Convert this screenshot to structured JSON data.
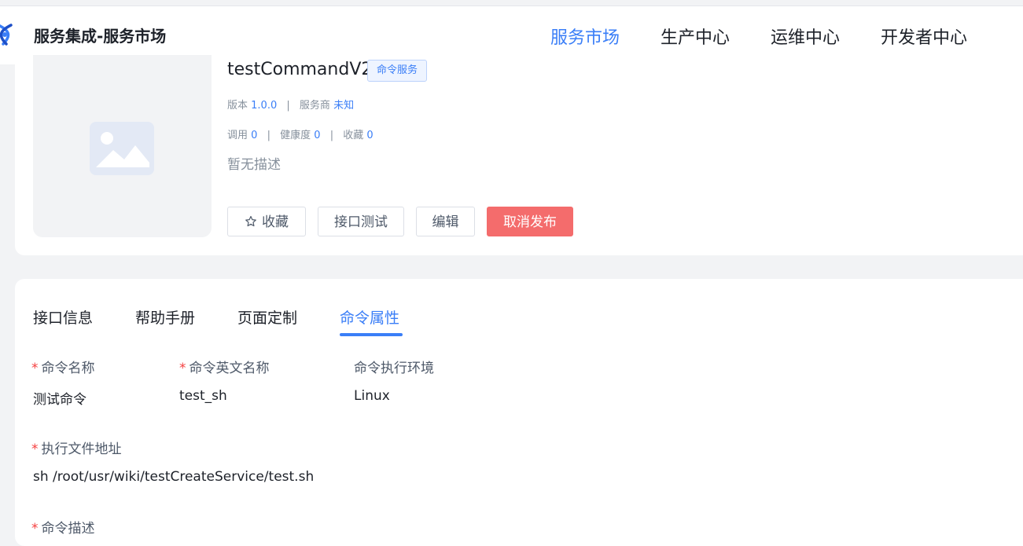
{
  "header": {
    "app_title": "服务集成-服务市场",
    "nav": [
      "服务市场",
      "生产中心",
      "运维中心",
      "开发者中心"
    ],
    "active_nav": "服务市场"
  },
  "service": {
    "name": "testCommandV2",
    "tag": "命令服务",
    "version_label": "版本",
    "version": "1.0.0",
    "provider_label": "服务商",
    "provider": "未知",
    "calls_label": "调用",
    "calls": "0",
    "health_label": "健康度",
    "health": "0",
    "favorites_label": "收藏",
    "favorites": "0",
    "separator": "|",
    "description": "暂无描述"
  },
  "actions": {
    "favorite": "收藏",
    "api_test": "接口测试",
    "edit": "编辑",
    "unpublish": "取消发布"
  },
  "tabs": {
    "items": [
      "接口信息",
      "帮助手册",
      "页面定制",
      "命令属性"
    ],
    "active": "命令属性"
  },
  "fields": {
    "required_mark": "*",
    "command_name": {
      "label": "命令名称",
      "value": "测试命令"
    },
    "command_en_name": {
      "label": "命令英文名称",
      "value": "test_sh"
    },
    "exec_env": {
      "label": "命令执行环境",
      "value": "Linux"
    },
    "exec_path": {
      "label": "执行文件地址",
      "value": "sh /root/usr/wiki/testCreateService/test.sh"
    },
    "command_desc": {
      "label": "命令描述"
    }
  },
  "colors": {
    "accent": "#3a7ef7",
    "danger": "#f46c6c",
    "required": "#f53f3f"
  }
}
